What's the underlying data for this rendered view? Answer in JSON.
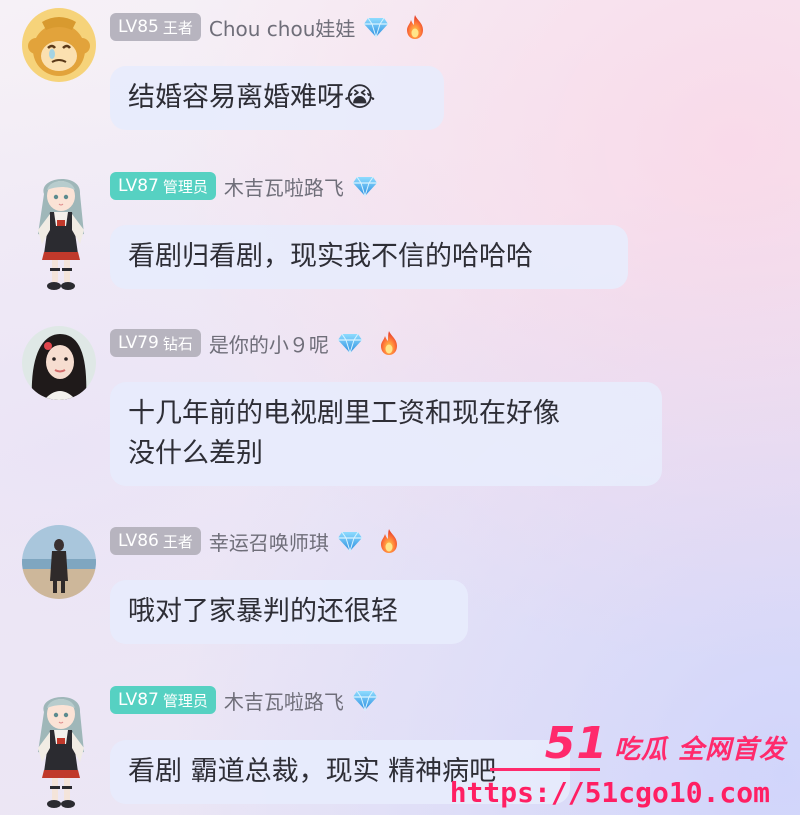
{
  "messages": [
    {
      "level": "LV85",
      "rank": "王者",
      "name": "Chou chou娃娃",
      "text_lines": [
        "结婚容易离婚难呀😭"
      ],
      "badges": [
        "diamond-icon",
        "flame-icon"
      ],
      "avatar": "monkey-avatar"
    },
    {
      "level": "LV87",
      "rank": "管理员",
      "name": "木吉瓦啦路飞",
      "text_lines": [
        "看剧归看剧，现实我不信的哈哈哈"
      ],
      "badges": [
        "diamond-icon"
      ],
      "avatar": "anime-girl-figure"
    },
    {
      "level": "LV79",
      "rank": "钻石",
      "name": "是你的小９呢",
      "text_lines": [
        "十几年前的电视剧里工资和现在好像",
        "没什么差别"
      ],
      "badges": [
        "diamond-icon",
        "flame-icon"
      ],
      "avatar": "woman-photo-avatar"
    },
    {
      "level": "LV86",
      "rank": "王者",
      "name": "幸运召唤师琪",
      "text_lines": [
        "哦对了家暴判的还很轻"
      ],
      "badges": [
        "diamond-icon",
        "flame-icon"
      ],
      "avatar": "beach-photo-avatar"
    },
    {
      "level": "LV87",
      "rank": "管理员",
      "name": "木吉瓦啦路飞",
      "text_lines": [
        "看剧 霸道总裁，现实 精神病吧"
      ],
      "badges": [
        "diamond-icon"
      ],
      "avatar": "anime-girl-figure"
    }
  ],
  "watermark": {
    "number": "51",
    "slogan": "吃瓜 全网首发",
    "url": "https://51cgo10.com"
  },
  "colors": {
    "bubble": "#e7ecfc",
    "level_gray": "#b7b4bf",
    "level_teal": "#56d1c2",
    "name": "#6f6e79",
    "text": "#2e2e36",
    "watermark": "#ff2a6c",
    "diamond": "#4fb6f0",
    "flame": "#f0603a"
  }
}
